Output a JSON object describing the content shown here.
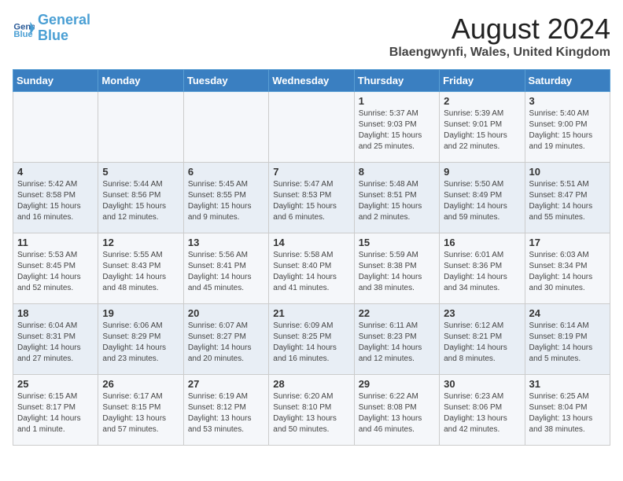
{
  "logo": {
    "line1": "General",
    "line2": "Blue"
  },
  "title": "August 2024",
  "subtitle": "Blaengwynfi, Wales, United Kingdom",
  "days_of_week": [
    "Sunday",
    "Monday",
    "Tuesday",
    "Wednesday",
    "Thursday",
    "Friday",
    "Saturday"
  ],
  "weeks": [
    [
      {
        "day": "",
        "info": ""
      },
      {
        "day": "",
        "info": ""
      },
      {
        "day": "",
        "info": ""
      },
      {
        "day": "",
        "info": ""
      },
      {
        "day": "1",
        "info": "Sunrise: 5:37 AM\nSunset: 9:03 PM\nDaylight: 15 hours\nand 25 minutes."
      },
      {
        "day": "2",
        "info": "Sunrise: 5:39 AM\nSunset: 9:01 PM\nDaylight: 15 hours\nand 22 minutes."
      },
      {
        "day": "3",
        "info": "Sunrise: 5:40 AM\nSunset: 9:00 PM\nDaylight: 15 hours\nand 19 minutes."
      }
    ],
    [
      {
        "day": "4",
        "info": "Sunrise: 5:42 AM\nSunset: 8:58 PM\nDaylight: 15 hours\nand 16 minutes."
      },
      {
        "day": "5",
        "info": "Sunrise: 5:44 AM\nSunset: 8:56 PM\nDaylight: 15 hours\nand 12 minutes."
      },
      {
        "day": "6",
        "info": "Sunrise: 5:45 AM\nSunset: 8:55 PM\nDaylight: 15 hours\nand 9 minutes."
      },
      {
        "day": "7",
        "info": "Sunrise: 5:47 AM\nSunset: 8:53 PM\nDaylight: 15 hours\nand 6 minutes."
      },
      {
        "day": "8",
        "info": "Sunrise: 5:48 AM\nSunset: 8:51 PM\nDaylight: 15 hours\nand 2 minutes."
      },
      {
        "day": "9",
        "info": "Sunrise: 5:50 AM\nSunset: 8:49 PM\nDaylight: 14 hours\nand 59 minutes."
      },
      {
        "day": "10",
        "info": "Sunrise: 5:51 AM\nSunset: 8:47 PM\nDaylight: 14 hours\nand 55 minutes."
      }
    ],
    [
      {
        "day": "11",
        "info": "Sunrise: 5:53 AM\nSunset: 8:45 PM\nDaylight: 14 hours\nand 52 minutes."
      },
      {
        "day": "12",
        "info": "Sunrise: 5:55 AM\nSunset: 8:43 PM\nDaylight: 14 hours\nand 48 minutes."
      },
      {
        "day": "13",
        "info": "Sunrise: 5:56 AM\nSunset: 8:41 PM\nDaylight: 14 hours\nand 45 minutes."
      },
      {
        "day": "14",
        "info": "Sunrise: 5:58 AM\nSunset: 8:40 PM\nDaylight: 14 hours\nand 41 minutes."
      },
      {
        "day": "15",
        "info": "Sunrise: 5:59 AM\nSunset: 8:38 PM\nDaylight: 14 hours\nand 38 minutes."
      },
      {
        "day": "16",
        "info": "Sunrise: 6:01 AM\nSunset: 8:36 PM\nDaylight: 14 hours\nand 34 minutes."
      },
      {
        "day": "17",
        "info": "Sunrise: 6:03 AM\nSunset: 8:34 PM\nDaylight: 14 hours\nand 30 minutes."
      }
    ],
    [
      {
        "day": "18",
        "info": "Sunrise: 6:04 AM\nSunset: 8:31 PM\nDaylight: 14 hours\nand 27 minutes."
      },
      {
        "day": "19",
        "info": "Sunrise: 6:06 AM\nSunset: 8:29 PM\nDaylight: 14 hours\nand 23 minutes."
      },
      {
        "day": "20",
        "info": "Sunrise: 6:07 AM\nSunset: 8:27 PM\nDaylight: 14 hours\nand 20 minutes."
      },
      {
        "day": "21",
        "info": "Sunrise: 6:09 AM\nSunset: 8:25 PM\nDaylight: 14 hours\nand 16 minutes."
      },
      {
        "day": "22",
        "info": "Sunrise: 6:11 AM\nSunset: 8:23 PM\nDaylight: 14 hours\nand 12 minutes."
      },
      {
        "day": "23",
        "info": "Sunrise: 6:12 AM\nSunset: 8:21 PM\nDaylight: 14 hours\nand 8 minutes."
      },
      {
        "day": "24",
        "info": "Sunrise: 6:14 AM\nSunset: 8:19 PM\nDaylight: 14 hours\nand 5 minutes."
      }
    ],
    [
      {
        "day": "25",
        "info": "Sunrise: 6:15 AM\nSunset: 8:17 PM\nDaylight: 14 hours\nand 1 minute."
      },
      {
        "day": "26",
        "info": "Sunrise: 6:17 AM\nSunset: 8:15 PM\nDaylight: 13 hours\nand 57 minutes."
      },
      {
        "day": "27",
        "info": "Sunrise: 6:19 AM\nSunset: 8:12 PM\nDaylight: 13 hours\nand 53 minutes."
      },
      {
        "day": "28",
        "info": "Sunrise: 6:20 AM\nSunset: 8:10 PM\nDaylight: 13 hours\nand 50 minutes."
      },
      {
        "day": "29",
        "info": "Sunrise: 6:22 AM\nSunset: 8:08 PM\nDaylight: 13 hours\nand 46 minutes."
      },
      {
        "day": "30",
        "info": "Sunrise: 6:23 AM\nSunset: 8:06 PM\nDaylight: 13 hours\nand 42 minutes."
      },
      {
        "day": "31",
        "info": "Sunrise: 6:25 AM\nSunset: 8:04 PM\nDaylight: 13 hours\nand 38 minutes."
      }
    ]
  ]
}
